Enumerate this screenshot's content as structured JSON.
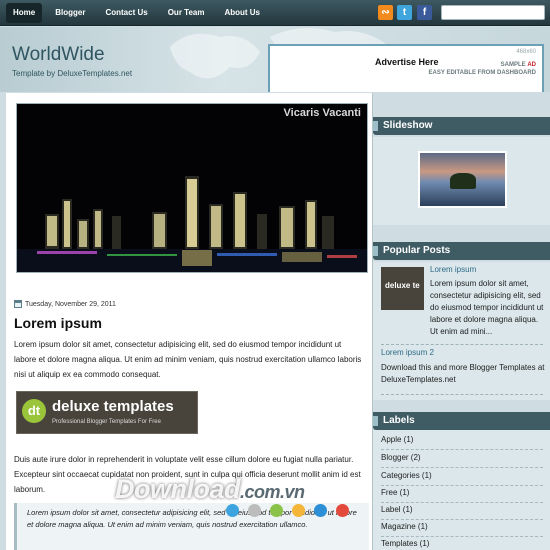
{
  "nav": {
    "items": [
      "Home",
      "Blogger",
      "Contact Us",
      "Our Team",
      "About Us"
    ],
    "active": "Home"
  },
  "social": {
    "rss": "rss-icon",
    "twitter": "twitter-icon",
    "facebook": "facebook-icon"
  },
  "search": {
    "value": ""
  },
  "header": {
    "title": "WorldWide",
    "subtitle": "Template by DeluxeTemplates.net",
    "ad": {
      "title": "Advertise Here",
      "size": "468x60",
      "sample": "SAMPLE",
      "sample_accent": "AD",
      "note": "EASY EDITABLE FROM DASHBOARD"
    }
  },
  "post": {
    "slide_caption": "Vicaris Vacanti",
    "date": "Tuesday, November 29, 2011",
    "title": "Lorem ipsum",
    "paragraph1": "Lorem ipsum dolor sit amet, consectetur adipisicing elit, sed do eiusmod tempor incididunt ut labore et dolore magna aliqua. Ut enim ad minim veniam, quis nostrud exercitation ullamco laboris nisi ut aliquip ex ea commodo consequat.",
    "banner": {
      "logo": "dt",
      "name": "deluxe templates",
      "tagline": "Professional Blogger Templates For Free"
    },
    "paragraph2": "Duis aute irure dolor in reprehenderit in voluptate velit esse cillum dolore eu fugiat nulla pariatur. Excepteur sint occaecat cupidatat non proident, sunt in culpa qui officia deserunt mollit anim id est laborum.",
    "quote": "Lorem ipsum dolor sit amet, consectetur adipisicing elit, sed do eiusmod tempor incididunt ut labore et dolore magna aliqua. Ut enim ad minim veniam, quis nostrud exercitation ullamco."
  },
  "sidebar": {
    "slideshow_title": "Slideshow",
    "popular_title": "Popular Posts",
    "popular": [
      {
        "title": "Lorem ipsum",
        "text": "Lorem ipsum dolor sit amet, consectetur adipisicing elit, sed do eiusmod tempor incididunt ut labore et dolore magna aliqua. Ut enim ad mini..."
      },
      {
        "title": "Lorem ipsum 2",
        "text": "Download this and more Blogger Templates at DeluxeTemplates.net"
      }
    ],
    "popular_thumb_text": "deluxe te",
    "labels_title": "Labels",
    "labels": [
      "Apple (1)",
      "Blogger (2)",
      "Categories (1)",
      "Free (1)",
      "Label (1)",
      "Magazine (1)",
      "Templates (1)"
    ]
  },
  "watermark": {
    "text": "Download",
    "suffix": ".com.vn",
    "dot_colors": [
      "#3da4e0",
      "#bcbcbc",
      "#8bc34a",
      "#f4b638",
      "#2d8fd6",
      "#e44a3c"
    ]
  }
}
